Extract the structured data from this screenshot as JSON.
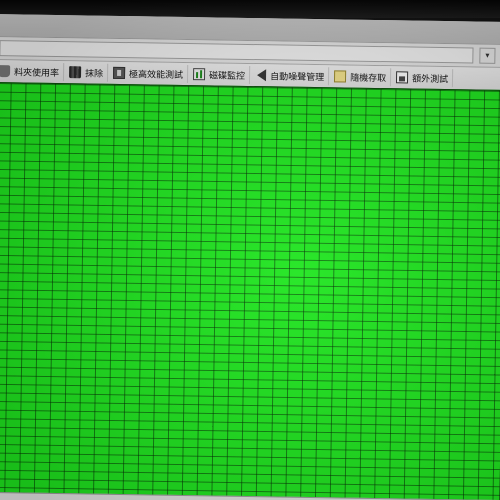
{
  "toolbar": {
    "items": [
      {
        "label": "料夾使用率",
        "icon": "database-icon"
      },
      {
        "label": "抹除",
        "icon": "trash-icon"
      },
      {
        "label": "極高效能測試",
        "icon": "benchmark-icon"
      },
      {
        "label": "磁碟監控",
        "icon": "monitor-chart-icon"
      },
      {
        "label": "自動噪聲管理",
        "icon": "speaker-icon"
      },
      {
        "label": "隨機存取",
        "icon": "note-icon"
      },
      {
        "label": "額外測試",
        "icon": "extra-test-icon"
      }
    ]
  },
  "address_dropdown_glyph": "▾",
  "colors": {
    "grid_fill": "#1ee61e",
    "grid_lines": "#0a3a0a"
  }
}
